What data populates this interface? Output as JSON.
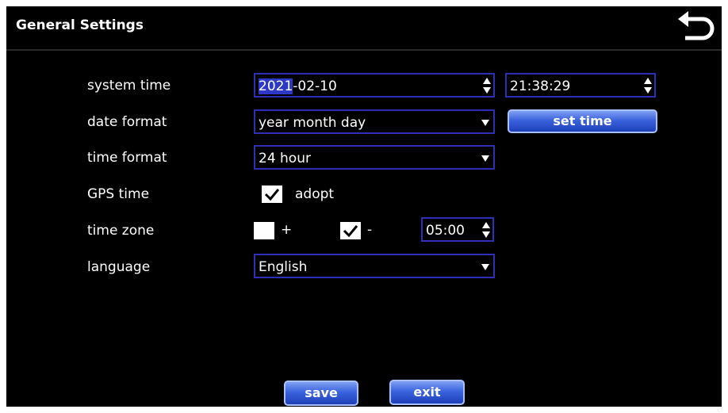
{
  "header": {
    "title": "General Settings",
    "back_icon": "back-arrow-icon"
  },
  "rows": {
    "system_time": {
      "label": "system time",
      "date_highlight": "2021",
      "date_rest": "-02-10",
      "time": "21:38:29"
    },
    "date_format": {
      "label": "date format",
      "value": "year month day",
      "set_time_label": "set time"
    },
    "time_format": {
      "label": "time format",
      "value": "24 hour"
    },
    "gps_time": {
      "label": "GPS time",
      "checked": true,
      "option_label": "adopt"
    },
    "time_zone": {
      "label": "time zone",
      "plus_label": "+",
      "plus_checked": false,
      "minus_label": "-",
      "minus_checked": true,
      "offset": "05:00"
    },
    "language": {
      "label": "language",
      "value": "English"
    }
  },
  "footer": {
    "save_label": "save",
    "exit_label": "exit"
  },
  "colors": {
    "background": "#000000",
    "field_border": "#2e2eb8",
    "highlight": "#2d39c6",
    "button": "#3b63de"
  }
}
